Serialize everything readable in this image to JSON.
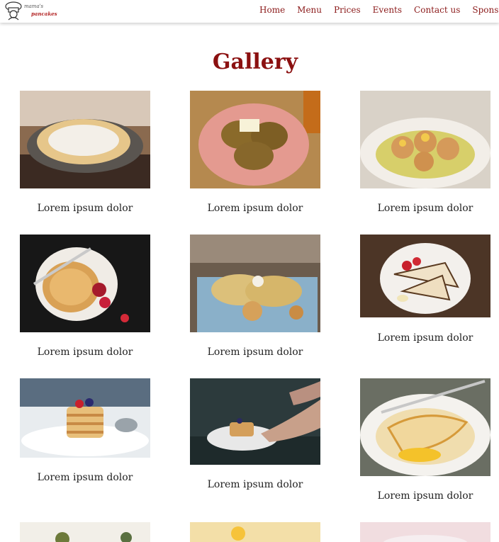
{
  "header": {
    "logo_top": "mama's",
    "logo_bottom": "pancakes",
    "nav": [
      "Home",
      "Menu",
      "Prices",
      "Events",
      "Contact us",
      "Sponsors"
    ]
  },
  "gallery": {
    "title": "Gallery",
    "items": [
      {
        "caption": "Lorem ipsum dolor"
      },
      {
        "caption": "Lorem ipsum dolor"
      },
      {
        "caption": "Lorem ipsum dolor"
      },
      {
        "caption": "Lorem ipsum dolor"
      },
      {
        "caption": "Lorem ipsum dolor"
      },
      {
        "caption": "Lorem ipsum dolor"
      },
      {
        "caption": "Lorem ipsum dolor"
      },
      {
        "caption": "Lorem ipsum dolor"
      },
      {
        "caption": "Lorem ipsum dolor"
      }
    ]
  }
}
